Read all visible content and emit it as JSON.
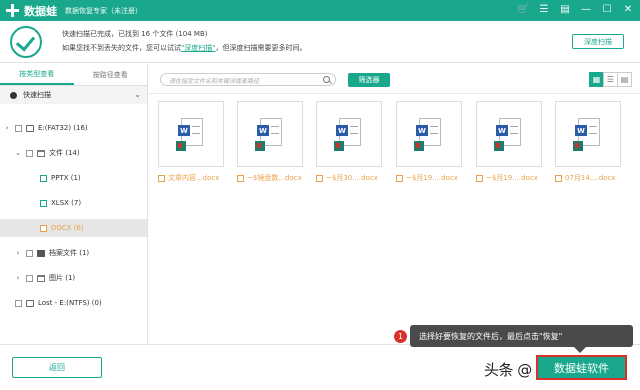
{
  "titlebar": {
    "app_name": "数据蛙",
    "subtitle": "数据恢复专家（未注册）",
    "icons": [
      "cart-icon",
      "menu-icon",
      "lock-icon",
      "minimize-icon",
      "maximize-icon",
      "close-icon"
    ],
    "icon_glyphs": [
      "🛒",
      "☰",
      "▤",
      "—",
      "☐",
      "✕"
    ]
  },
  "status": {
    "line1": "快速扫描已完成，已找到 16 个文件 (104 MB)",
    "line2_before": "如果您找不到丢失的文件，您可以试试",
    "line2_link": "\"深度扫描\"",
    "line2_after": "，但深度扫描需要更多时间。",
    "deep_scan_button": "深度扫描"
  },
  "sidebar": {
    "tabs": [
      "按类型查看",
      "按路径查看"
    ],
    "active_tab": 0,
    "scan_type": "快速扫描",
    "tree": [
      {
        "label": "E:(FAT32) (16)",
        "arrow": "›"
      },
      {
        "label": "文件 (14)",
        "arrow": "⌄"
      },
      {
        "label": "PPTX (1)",
        "arrow": ""
      },
      {
        "label": "XLSX (7)",
        "arrow": ""
      },
      {
        "label": "DOCX (6)",
        "arrow": ""
      },
      {
        "label": "档案文件 (1)",
        "arrow": "›"
      },
      {
        "label": "图片 (1)",
        "arrow": "›"
      },
      {
        "label": "Lost - E:(NTFS) (0)",
        "arrow": ""
      }
    ]
  },
  "main": {
    "search_placeholder": "请在指定文件名和关键词或者路径",
    "filter_button": "筛选器",
    "view_modes": [
      "grid-view-icon",
      "list-view-icon",
      "detail-view-icon"
    ],
    "view_glyphs": [
      "▦",
      "☰",
      "▤"
    ],
    "active_view": 0,
    "files": [
      {
        "name": "文章内容...docx"
      },
      {
        "name": "~$镜盘数...docx"
      },
      {
        "name": "~$月30....docx"
      },
      {
        "name": "~$月19....docx"
      },
      {
        "name": "~$月19....docx"
      },
      {
        "name": "07月14....docx"
      }
    ]
  },
  "bottom": {
    "back_button": "返回",
    "recover_button": "数据蛙软件",
    "watermark": "头条 @"
  },
  "tooltip": {
    "step": "1",
    "text": "选择好要恢复的文件后，最后点击\"恢复\""
  },
  "colors": {
    "brand": "#19a88c",
    "highlight": "#d9302b",
    "file_label": "#e9a34a"
  }
}
